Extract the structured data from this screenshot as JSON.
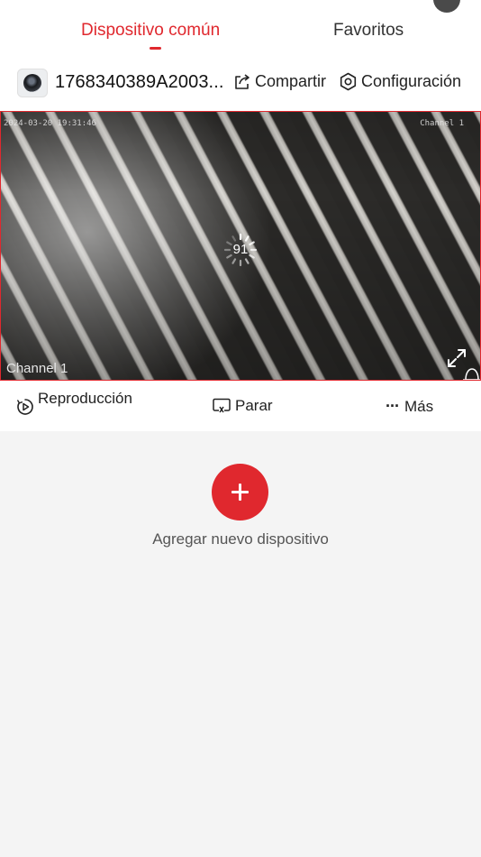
{
  "tabs": {
    "common_label": "Dispositivo común",
    "favorites_label": "Favoritos"
  },
  "device": {
    "name": "1768340389A2003...",
    "share_label": "Compartir",
    "config_label": "Configuración"
  },
  "video": {
    "osd_timestamp": "2024-03-20 19:31:46",
    "osd_channel": "Channel 1",
    "channel_label": "Channel 1",
    "loading_value": "91"
  },
  "controls": {
    "playback_label": "Reproducción",
    "stop_label": "Parar",
    "more_label": "Más"
  },
  "empty": {
    "add_label": "Agregar nuevo dispositivo"
  },
  "colors": {
    "accent": "#e0282e",
    "background": "#f4f4f4"
  },
  "icons": [
    "list-icon",
    "add-icon",
    "user-icon",
    "share-icon",
    "settings-icon",
    "spinner-icon",
    "fullscreen-icon",
    "alarm-icon",
    "playback-icon",
    "stop-icon",
    "more-icon",
    "plus-icon"
  ]
}
